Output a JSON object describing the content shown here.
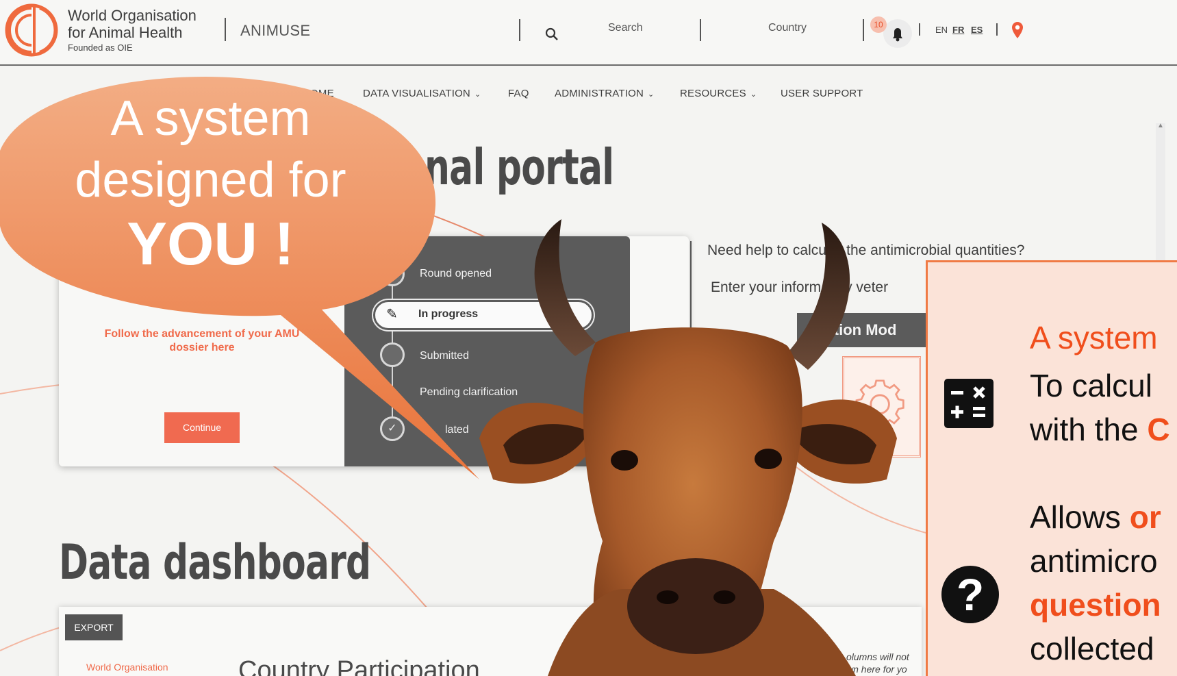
{
  "header": {
    "org_name_line1": "World Organisation",
    "org_name_line2": "for Animal Health",
    "founded": "Founded as OIE",
    "app_name": "ANIMUSE",
    "search_label": "Search",
    "country_label": "Country",
    "notification_count": "10",
    "languages": [
      "EN",
      "FR",
      "ES"
    ]
  },
  "nav": {
    "home": "HOME",
    "data_visualisation": "DATA VISUALISATION",
    "faq": "FAQ",
    "administration": "ADMINISTRATION",
    "resources": "RESOURCES",
    "user_support": "USER SUPPORT"
  },
  "main": {
    "portal_title": "nal portal",
    "follow_text": "Follow the advancement of your AMU dossier here",
    "continue_label": "Continue",
    "timeline": [
      "Round opened",
      "In progress",
      "Submitted",
      "Pending clarification",
      "lated"
    ],
    "help_title": "Need help to calcu   te the antimicrobial quantities?",
    "enter_text": "Enter your inform     n by veter",
    "calc_module_label": "ulation Mod",
    "dashboard_title": "Data dashboard",
    "export_label": "EXPORT",
    "wo_small": "World Organisation",
    "country_participation": "Country Participation",
    "columns_note_1": "olumns will not",
    "columns_note_2": "wn here for yo"
  },
  "bubble": {
    "line1": "A system",
    "line2": "designed for",
    "line3": "YOU !"
  },
  "info_card": {
    "line1": "A system",
    "line2": "To calcul",
    "line3_prefix": "with the ",
    "line3_suffix": "C",
    "line4_prefix": "Allows ",
    "line4_suffix": "or",
    "line5": "antimicro",
    "line6": "question",
    "line7": "collected"
  },
  "colors": {
    "accent": "#f06a4a",
    "bubble": "#ef8a55",
    "panel": "#5b5b5b",
    "info_border": "#f07a44",
    "info_bg": "#fbe3d8"
  },
  "icons": [
    "oie-logo-icon",
    "search-icon",
    "bell-icon",
    "map-pin-icon",
    "chevron-down-icon",
    "flag-icon",
    "pencil-icon",
    "check-icon",
    "gear-icon",
    "calculator-icon",
    "question-icon"
  ]
}
